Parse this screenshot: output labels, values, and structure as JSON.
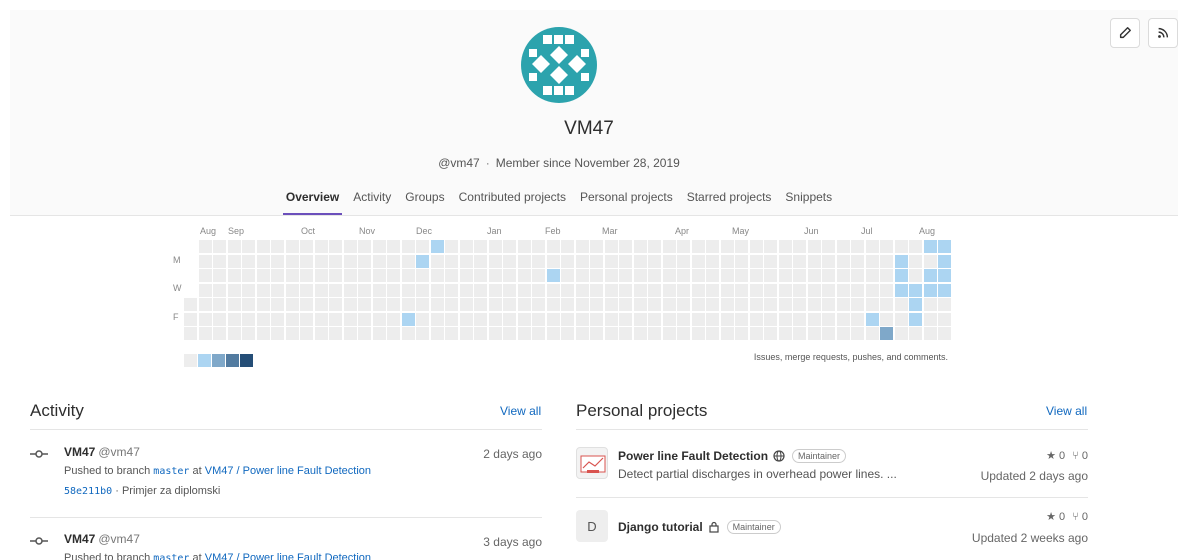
{
  "profile": {
    "name": "VM47",
    "handle": "@vm47",
    "separator": "·",
    "member_since": "Member since November 28, 2019"
  },
  "tabs": [
    {
      "label": "Overview",
      "active": true
    },
    {
      "label": "Activity",
      "active": false
    },
    {
      "label": "Groups",
      "active": false
    },
    {
      "label": "Contributed projects",
      "active": false
    },
    {
      "label": "Personal projects",
      "active": false
    },
    {
      "label": "Starred projects",
      "active": false
    },
    {
      "label": "Snippets",
      "active": false
    }
  ],
  "calendar": {
    "months": [
      "Aug",
      "Sep",
      "Oct",
      "Nov",
      "Dec",
      "Jan",
      "Feb",
      "Mar",
      "Apr",
      "May",
      "Jun",
      "Jul",
      "Aug"
    ],
    "day_labels": [
      "M",
      "W",
      "F"
    ],
    "weeks": 53,
    "levels": [
      "#ededed",
      "#acd5f2",
      "#7fa8c9",
      "#527ba0",
      "#254e77"
    ],
    "active_cells": [
      {
        "week": 17,
        "day": 0,
        "level": 1
      },
      {
        "week": 16,
        "day": 1,
        "level": 1
      },
      {
        "week": 15,
        "day": 5,
        "level": 1
      },
      {
        "week": 25,
        "day": 2,
        "level": 1
      },
      {
        "week": 47,
        "day": 5,
        "level": 1
      },
      {
        "week": 48,
        "day": 6,
        "level": 2
      },
      {
        "week": 49,
        "day": 1,
        "level": 1
      },
      {
        "week": 49,
        "day": 2,
        "level": 1
      },
      {
        "week": 49,
        "day": 3,
        "level": 1
      },
      {
        "week": 50,
        "day": 3,
        "level": 1
      },
      {
        "week": 50,
        "day": 4,
        "level": 1
      },
      {
        "week": 50,
        "day": 5,
        "level": 1
      },
      {
        "week": 51,
        "day": 0,
        "level": 1
      },
      {
        "week": 51,
        "day": 2,
        "level": 1
      },
      {
        "week": 51,
        "day": 3,
        "level": 1
      },
      {
        "week": 52,
        "day": 0,
        "level": 1
      },
      {
        "week": 52,
        "day": 1,
        "level": 1
      },
      {
        "week": 52,
        "day": 2,
        "level": 1
      },
      {
        "week": 52,
        "day": 3,
        "level": 1
      }
    ],
    "note": "Issues, merge requests, pushes, and comments."
  },
  "activity": {
    "title": "Activity",
    "view_all": "View all",
    "items": [
      {
        "user": "VM47",
        "handle": "@vm47",
        "time": "2 days ago",
        "pushed_prefix": "Pushed to branch",
        "branch": "master",
        "at": "at",
        "project": "VM47 / Power line Fault Detection",
        "commit": "58e211b0",
        "commit_msg": "· Primjer za diplomski"
      },
      {
        "user": "VM47",
        "handle": "@vm47",
        "time": "3 days ago",
        "pushed_prefix": "Pushed to branch",
        "branch": "master",
        "at": "at",
        "project": "VM47 / Power line Fault Detection"
      }
    ]
  },
  "projects": {
    "title": "Personal projects",
    "view_all": "View all",
    "items": [
      {
        "name": "Power line Fault Detection",
        "visibility_icon": "globe-icon",
        "role": "Maintainer",
        "description": "Detect partial discharges in overhead power lines. ...",
        "stars": "0",
        "forks": "0",
        "updated": "Updated 2 days ago"
      },
      {
        "avatar_letter": "D",
        "name": "Django tutorial",
        "visibility_icon": "lock-icon",
        "role": "Maintainer",
        "stars": "0",
        "forks": "0",
        "updated": "Updated 2 weeks ago"
      }
    ]
  },
  "colors": {
    "accent": "#6b4fbb",
    "link": "#1068bf",
    "avatar_bg": "#2ca3ad"
  }
}
